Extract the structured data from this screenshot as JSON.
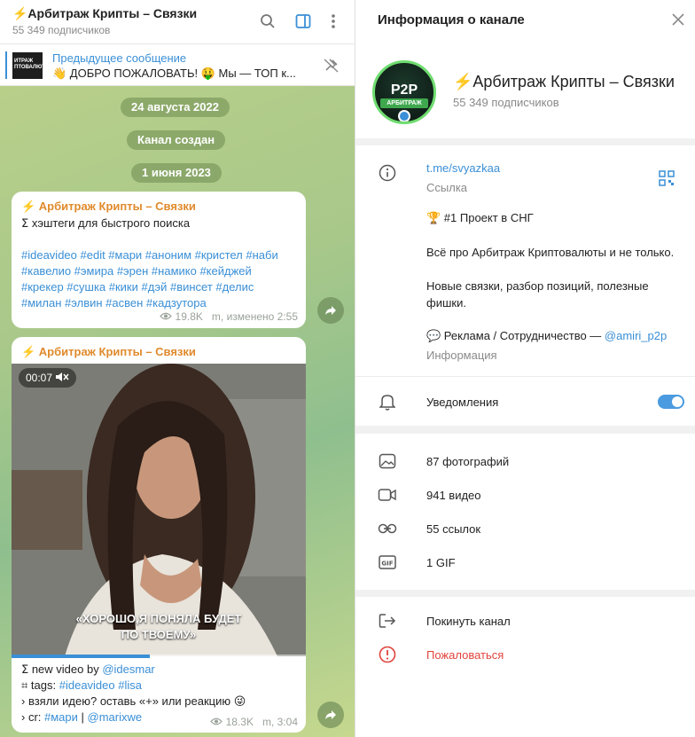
{
  "chat": {
    "title": "⚡️Арбитраж Крипты – Связки",
    "subscribers": "55 349 подписчиков"
  },
  "pinned": {
    "title": "Предыдущее сообщение",
    "text": "👋 ДОБРО ПОЖАЛОВАТЬ! 🤑 Мы — ТОП к...",
    "thumb_text": "ИТРАЖ ПТОВАЛЮТ"
  },
  "service": {
    "date1": "24 августа 2022",
    "created": "Канал создан",
    "date2": "1 июня 2023"
  },
  "post1": {
    "author": "⚡️ Арбитраж Крипты – Связки",
    "line1": "ⵉ хэштеги для быстрого поиска",
    "tags": [
      "#ideavideo #edit #мари #аноним #кристел #наби",
      "#кавелио #эмира #эрен #намико #кейджей",
      "#крекер #сушка #кики #дэй #винсет #делис",
      "#милан #элвин #асвен #кадзутора"
    ],
    "views": "19.8K",
    "time": "m, изменено 2:55"
  },
  "post2": {
    "author": "⚡️ Арбитраж Крипты – Связки",
    "duration": "00:07",
    "caption_line1": "«ХОРОШО,Я ПОНЯЛА БУДЕТ",
    "caption_line2": "ПО ТВОЕМУ»",
    "progress": 0.47,
    "line1_prefix": "ⵉ new video by ",
    "line1_link": "@idesmar",
    "line2_prefix": "⌗ tags: ",
    "line2_link": "#ideavideo #lisa",
    "line3": "› взяли идею? оставь «+» или реакцию 😜",
    "line4_prefix": "› cr: ",
    "line4_link1": "#мари",
    "line4_sep": " | ",
    "line4_link2": "@marixwe",
    "views": "18.3K",
    "time": "m, 3:04"
  },
  "info": {
    "title": "Информация о канале",
    "channel_name": "⚡️Арбитраж Крипты – Связки",
    "subscribers": "55 349 подписчиков",
    "avatar_text": "P2P",
    "avatar_sub": "АРБИТРАЖ",
    "link": "t.me/svyazkaa",
    "link_label": "Ссылка",
    "desc_line1": "🏆 #1 Проект в СНГ",
    "desc_para": "Всё про Арбитраж Криптовалюты и не только.",
    "desc_para2": "Новые связки, разбор позиций, полезные фишки.",
    "ads_prefix": "💬 Реклама / Сотрудничество — ",
    "ads_link": "@amiri_p2p",
    "info_label": "Информация",
    "notifications": "Уведомления",
    "notifications_on": true,
    "photos": "87 фотографий",
    "videos": "941 видео",
    "links": "55 ссылок",
    "gifs": "1 GIF",
    "leave": "Покинуть канал",
    "report": "Пожаловаться"
  },
  "colors": {
    "accent": "#3a8fd6",
    "danger": "#e0443c",
    "author": "#e08a2c",
    "toggle": "#4a9be0"
  }
}
